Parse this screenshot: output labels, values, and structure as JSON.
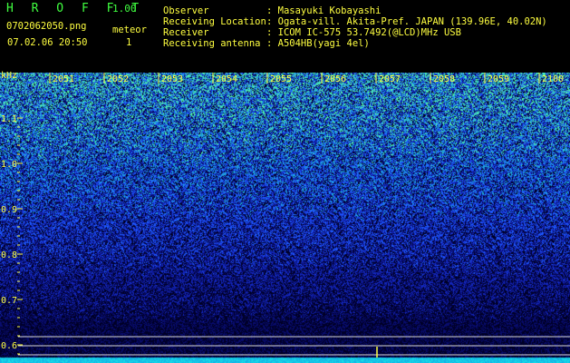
{
  "header": {
    "app_name": "H R O F F T",
    "app_version": "1.00",
    "filename": "0702062050.png",
    "date_time": "07.02.06 20:50",
    "meteor_label": "meteor",
    "meteor_count": "1",
    "info_labels": {
      "observer": "Observer",
      "location": "Receiving Location",
      "receiver": "Receiver",
      "antenna": "Receiving antenna"
    },
    "info_values": {
      "observer": ": Masayuki Kobayashi",
      "location": ": Ogata-vill. Akita-Pref. JAPAN (139.96E, 40.02N)",
      "receiver": ": ICOM IC-575 53.7492(@LCD)MHz USB",
      "antenna": ": A504HB(yagi 4el)"
    }
  },
  "chart_data": {
    "type": "heatmap",
    "ylabel": "kHz",
    "y_ticks": [
      "1.1",
      "1.0",
      "0.9",
      "0.8",
      "0.7",
      "0.6"
    ],
    "x_ticks": [
      "2051",
      "2052",
      "2053",
      "2054",
      "2055",
      "2056",
      "2057",
      "2058",
      "2059",
      "2100"
    ],
    "colors": {
      "high": "#60ffb0",
      "mid": "#2060ff",
      "low": "#000010",
      "accent": "#ffff40"
    }
  }
}
